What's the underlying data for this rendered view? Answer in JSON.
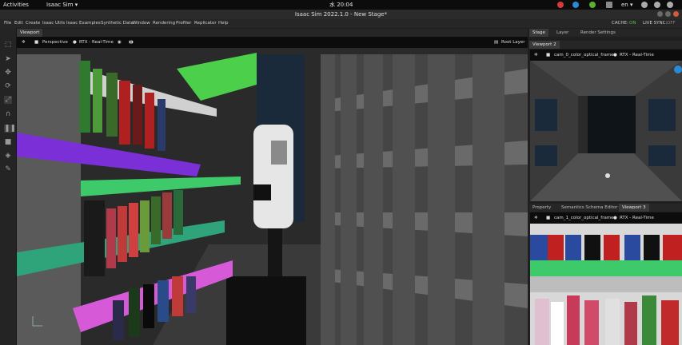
{
  "gnome_bar": {
    "activities": "Activities",
    "app_menu": "Isaac Sim ▾",
    "clock": "水 20:04",
    "lang": "en ▾"
  },
  "window": {
    "title": "Isaac Sim 2022.1.0 - New Stage*"
  },
  "menu": {
    "items": [
      "File",
      "Edit",
      "Create",
      "Isaac Utils",
      "Isaac Examples",
      "Synthetic Data",
      "Window",
      "Rendering",
      "Profiler",
      "Replicator",
      "Help"
    ],
    "cache_label": "CACHE:",
    "cache_value": "ON",
    "live_sync_label": "LIVE SYNC:",
    "live_sync_value": "OFF"
  },
  "main_viewport": {
    "tab": "Viewport",
    "camera": "Perspective",
    "renderer": "RTX - Real-Time",
    "stage_light": "Root Layer"
  },
  "right_top": {
    "tabs": [
      "Stage",
      "Layer",
      "Render Settings"
    ],
    "viewport_tab": "Viewport 2",
    "camera": "cam_0_color_optical_frame",
    "renderer": "RTX - Real-Time"
  },
  "right_bottom": {
    "tabs": [
      "Property",
      "Semantics Schema Editor",
      "Viewport 3"
    ],
    "camera": "cam_1_color_optical_frame",
    "renderer": "RTX - Real-Time"
  },
  "colors": {
    "purple_shelf": "#7b2fd6",
    "green_shelf": "#3ec96a",
    "pink_shelf": "#d65ad8",
    "teal_shelf": "#2fa37a",
    "cache_on": "#59c24f"
  }
}
